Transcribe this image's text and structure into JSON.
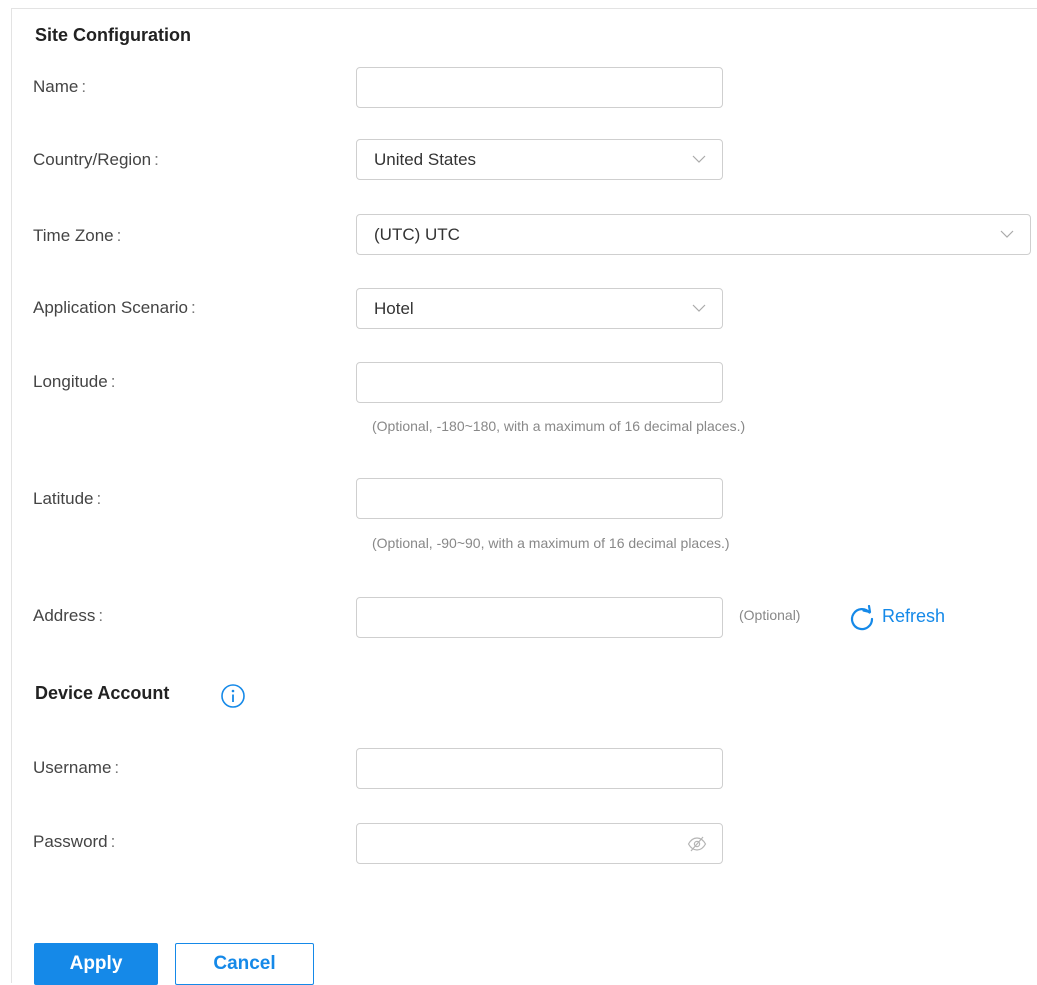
{
  "site": {
    "title": "Site Configuration",
    "fields": {
      "name": {
        "label": "Name",
        "value": "",
        "placeholder": ""
      },
      "country": {
        "label": "Country/Region",
        "selected": "United States"
      },
      "timezone": {
        "label": "Time Zone",
        "selected": "(UTC) UTC"
      },
      "scenario": {
        "label": "Application Scenario",
        "selected": "Hotel"
      },
      "longitude": {
        "label": "Longitude",
        "value": "",
        "hint": "(Optional, -180~180, with a maximum of 16 decimal places.)"
      },
      "latitude": {
        "label": "Latitude",
        "value": "",
        "hint": "(Optional, -90~90, with a maximum of 16 decimal places.)"
      },
      "address": {
        "label": "Address",
        "value": "",
        "hint": "(Optional)",
        "refresh_label": "Refresh"
      }
    }
  },
  "device_account": {
    "title": "Device Account",
    "info_icon": "info-icon",
    "fields": {
      "username": {
        "label": "Username",
        "value": ""
      },
      "password": {
        "label": "Password",
        "value": "",
        "toggle_icon": "eye-off-icon"
      }
    }
  },
  "actions": {
    "apply_label": "Apply",
    "cancel_label": "Cancel"
  },
  "colors": {
    "accent": "#1589e8",
    "border": "#cfcfcf",
    "label": "#444444",
    "hint": "#888888"
  },
  "colon": ":"
}
